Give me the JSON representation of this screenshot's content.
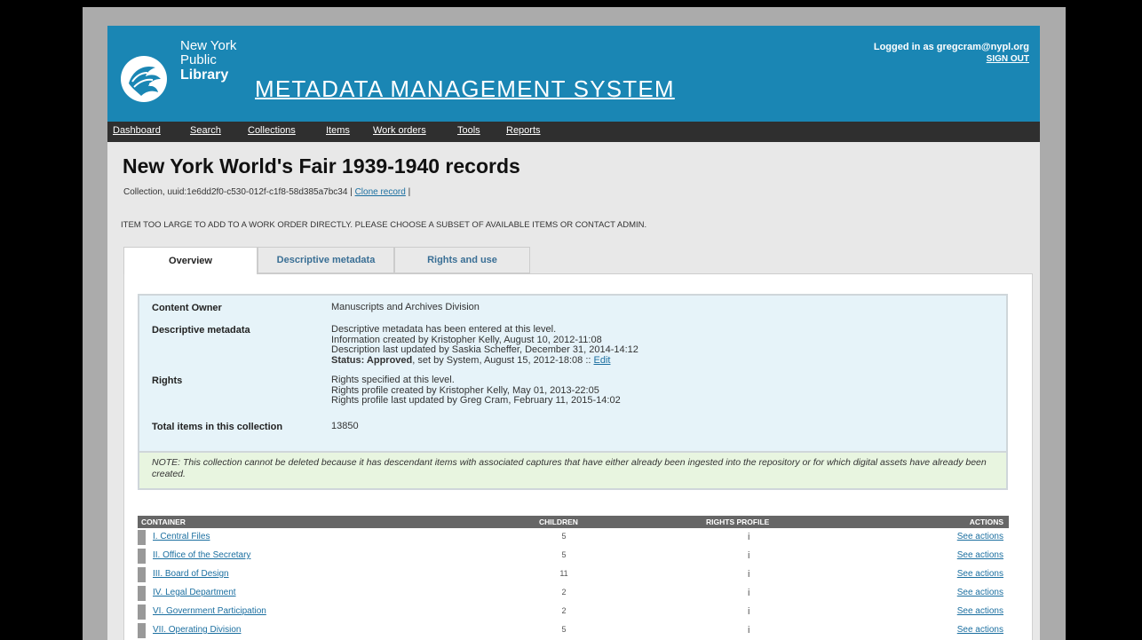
{
  "header": {
    "org_line1": "New York",
    "org_line2": "Public",
    "org_line3": "Library",
    "app_title": "METADATA MANAGEMENT SYSTEM",
    "login_text": "Logged in as gregcram@nypl.org",
    "signout_label": "SIGN OUT"
  },
  "nav": {
    "items": [
      "Dashboard",
      "Search",
      "Collections",
      "Items",
      "Work orders",
      "Tools",
      "Reports"
    ]
  },
  "record": {
    "title": "New York World's Fair 1939-1940 records",
    "meta_prefix": "Collection, uuid:1e6dd2f0-c530-012f-c1f8-58d385a7bc34 | ",
    "clone_label": "Clone record",
    "meta_suffix": " |",
    "warning": "ITEM TOO LARGE TO ADD TO A WORK ORDER DIRECTLY. PLEASE CHOOSE A SUBSET OF AVAILABLE ITEMS OR CONTACT ADMIN."
  },
  "tabs": [
    "Overview",
    "Descriptive metadata",
    "Rights and use"
  ],
  "summary": {
    "content_owner_label": "Content Owner",
    "content_owner_value": "Manuscripts and Archives Division",
    "desc_label": "Descriptive metadata",
    "desc_line1": "Descriptive metadata has been entered at this level.",
    "desc_line2": "Information created by Kristopher Kelly, August 10, 2012-11:08",
    "desc_line3": "Description last updated by Saskia Scheffer, December 31, 2014-14:12",
    "status_label": "Status: Approved",
    "status_rest": ", set by System, August 15, 2012-18:08 :: ",
    "edit_label": "Edit",
    "rights_label": "Rights",
    "rights_line1": "Rights specified at this level.",
    "rights_line2": "Rights profile created by Kristopher Kelly, May 01, 2013-22:05",
    "rights_line3": "Rights profile last updated by Greg Cram, February 11, 2015-14:02",
    "total_label": "Total items in this collection",
    "total_value": "13850"
  },
  "note": "NOTE: This collection cannot be deleted because it has descendant items with associated captures that have either already been ingested into the repository or for which digital assets have already been created.",
  "table": {
    "headers": [
      "CONTAINER",
      "CHILDREN",
      "RIGHTS PROFILE",
      "ACTIONS"
    ],
    "rows": [
      {
        "name": "I. Central Files",
        "children": "5",
        "rights": "i",
        "action": "See actions"
      },
      {
        "name": "II. Office of the Secretary",
        "children": "5",
        "rights": "i",
        "action": "See actions"
      },
      {
        "name": "III. Board of Design",
        "children": "11",
        "rights": "i",
        "action": "See actions"
      },
      {
        "name": "IV. Legal Department",
        "children": "2",
        "rights": "i",
        "action": "See actions"
      },
      {
        "name": "VI. Government Participation",
        "children": "2",
        "rights": "i",
        "action": "See actions"
      },
      {
        "name": "VII. Operating Division",
        "children": "5",
        "rights": "i",
        "action": "See actions"
      }
    ]
  },
  "colors": {
    "header_blue": "#1a86b4",
    "nav_dark": "#2f2f2f",
    "link_blue": "#1b6fa0",
    "summary_bg": "#e6f3f9",
    "note_bg": "#e8f5e0"
  },
  "icons": {
    "logo": "nypl-lion-logo-icon"
  }
}
